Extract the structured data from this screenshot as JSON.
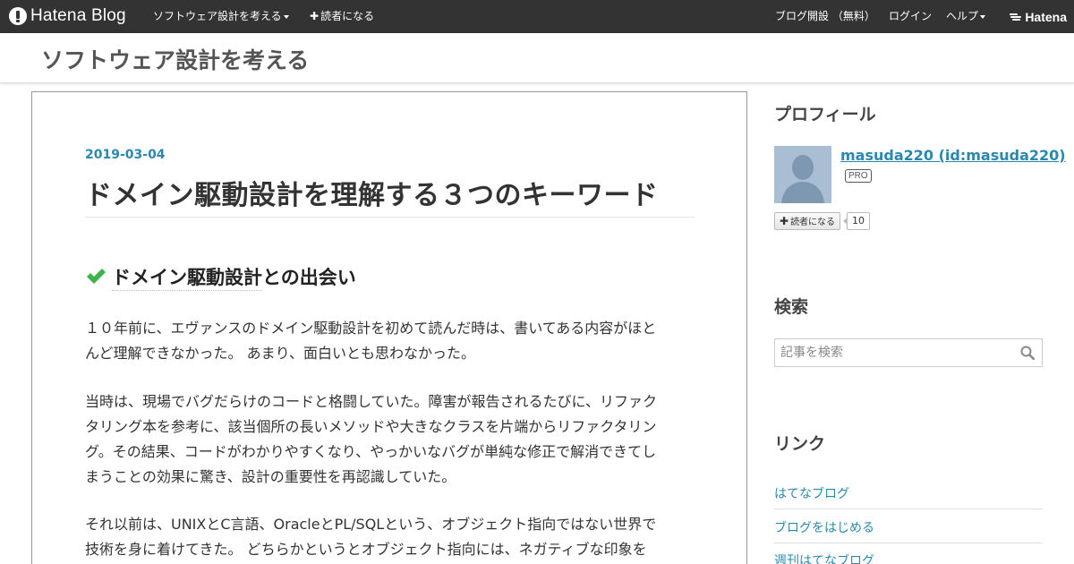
{
  "globalheader": {
    "logo_text": "Hatena Blog",
    "blog_menu_label": "ソフトウェア設計を考える",
    "subscribe_label": "読者になる",
    "open_blog_label": "ブログ開設 （無料）",
    "login_label": "ログイン",
    "help_label": "ヘルプ",
    "hatena_label": "Hatena"
  },
  "blog": {
    "title": "ソフトウェア設計を考える"
  },
  "entry": {
    "date": "2019-03-04",
    "title": "ドメイン駆動設計を理解する３つのキーワード",
    "section_heading_kw": "ドメイン駆動設計",
    "section_heading_rest": "との出会い",
    "paragraphs": [
      [
        "１０年前に、エヴァンスのドメイン駆動設計を初めて読んだ時は、書いてある内容がほと",
        "んど理解できなかった。 あまり、面白いとも思わなかった。"
      ],
      [
        "当時は、現場でバグだらけのコードと格闘していた。障害が報告されるたびに、リファク",
        "タリング本を参考に、該当個所の長いメソッドや大きなクラスを片端からリファクタリン",
        "グ。その結果、コードがわかりやすくなり、やっかいなバグが単純な修正で解消できてし",
        "まうことの効果に驚き、設計の重要性を再認識していた。"
      ],
      [
        "それ以前は、UNIXとC言語、OracleとPL/SQLという、オブジェクト指向ではない世界で",
        "技術を身に着けてきた。 どちらかというとオブジェクト指向には、ネガティブな印象を"
      ]
    ]
  },
  "sidebar": {
    "profile_heading": "プロフィール",
    "profile_name": "masuda220 (id:masuda220)",
    "pro_badge": "PRO",
    "subscribe_label": "読者になる",
    "reader_count": "10",
    "search_heading": "検索",
    "search_placeholder": "記事を検索",
    "links_heading": "リンク",
    "links": [
      "はてなブログ",
      "ブログをはじめる",
      "週刊はてなブログ"
    ]
  },
  "colors": {
    "header_bg": "#333333",
    "link": "#2a88b0",
    "check_green": "#3cb44b"
  },
  "icons": [
    "hatena-blog-logo-icon",
    "caret-down-icon",
    "plus-icon",
    "hatena-logo-icon",
    "check-icon",
    "avatar-silhouette-icon",
    "search-icon"
  ]
}
